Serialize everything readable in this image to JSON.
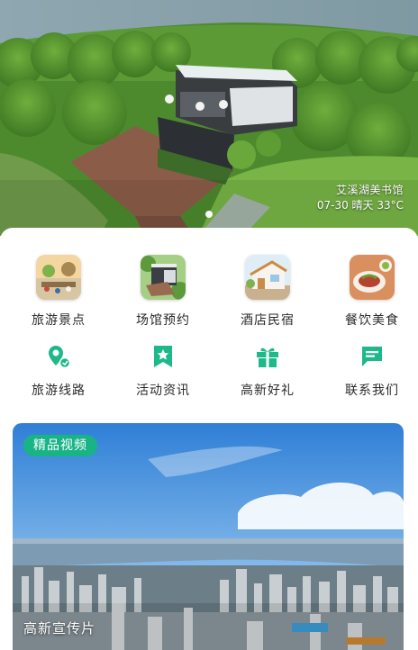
{
  "banner": {
    "caption_title": "艾溪湖美书馆",
    "caption_info": "07-30 晴天 33°C",
    "active_slide": 1,
    "slide_count": 1
  },
  "nav_grid": {
    "row1": [
      {
        "label": "旅游景点",
        "icon": "scenic-spot-icon"
      },
      {
        "label": "场馆预约",
        "icon": "venue-booking-icon"
      },
      {
        "label": "酒店民宿",
        "icon": "hotel-icon"
      },
      {
        "label": "餐饮美食",
        "icon": "food-icon"
      }
    ],
    "row2": [
      {
        "label": "旅游线路",
        "icon": "route-pin-icon"
      },
      {
        "label": "活动资讯",
        "icon": "bookmark-star-icon"
      },
      {
        "label": "高新好礼",
        "icon": "gift-icon"
      },
      {
        "label": "联系我们",
        "icon": "chat-bubble-icon"
      }
    ],
    "accent_color": "#1db98a"
  },
  "video": {
    "tag": "精品视频",
    "title": "高新宣传片"
  }
}
